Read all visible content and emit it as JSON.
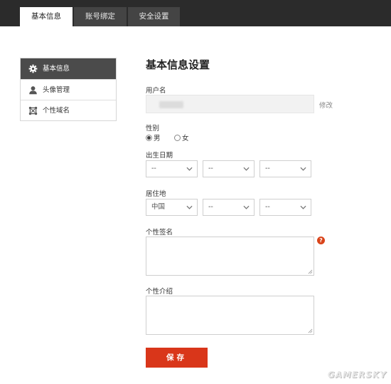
{
  "tabs": [
    {
      "label": "基本信息",
      "active": true
    },
    {
      "label": "账号绑定",
      "active": false
    },
    {
      "label": "安全设置",
      "active": false
    }
  ],
  "sidebar": {
    "items": [
      {
        "label": "基本信息",
        "icon": "gear-icon",
        "active": true
      },
      {
        "label": "头像管理",
        "icon": "user-icon",
        "active": false
      },
      {
        "label": "个性域名",
        "icon": "domain-icon",
        "active": false
      }
    ]
  },
  "form": {
    "title": "基本信息设置",
    "username_label": "用户名",
    "modify_label": "修改",
    "gender_label": "性别",
    "gender_male": "男",
    "gender_female": "女",
    "gender_selected": "男",
    "birthday_label": "出生日期",
    "birthday": {
      "year": "--",
      "month": "--",
      "day": "--"
    },
    "location_label": "居住地",
    "location": {
      "country": "中国",
      "province": "--",
      "city": "--"
    },
    "signature_label": "个性签名",
    "intro_label": "个性介绍",
    "save_label": "保存"
  },
  "colors": {
    "accent": "#d9361a",
    "topbar": "#2b2b2b",
    "active_side": "#4b4b4b"
  },
  "watermark": "GAMERSKY"
}
